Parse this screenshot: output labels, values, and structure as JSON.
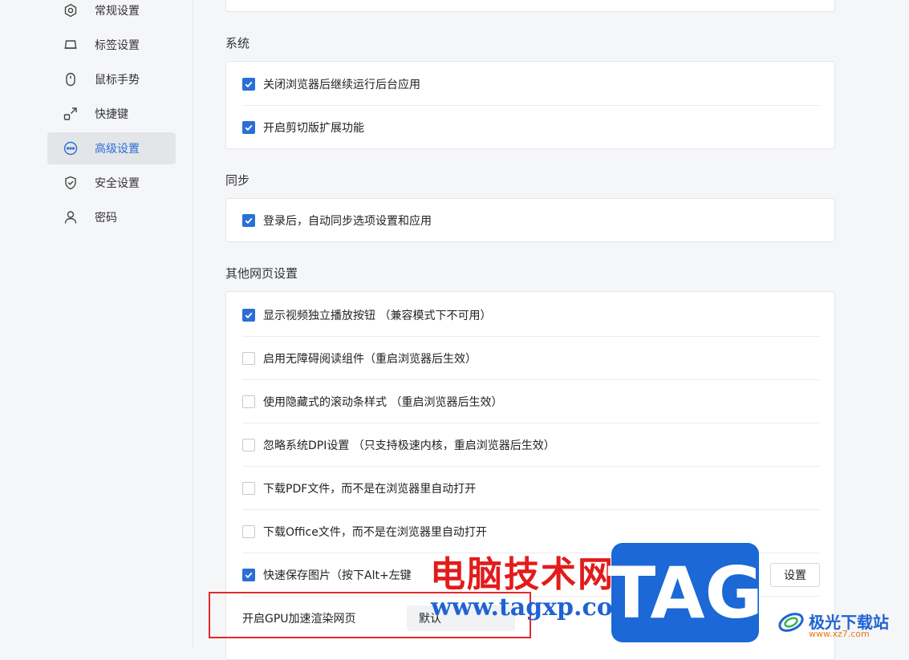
{
  "sidebar": {
    "items": [
      {
        "label": "常规设置",
        "icon": "hexagon-settings-icon"
      },
      {
        "label": "标签设置",
        "icon": "tab-icon"
      },
      {
        "label": "鼠标手势",
        "icon": "mouse-icon"
      },
      {
        "label": "快捷键",
        "icon": "shortcut-icon"
      },
      {
        "label": "高级设置",
        "icon": "more-icon",
        "active": true
      },
      {
        "label": "安全设置",
        "icon": "shield-icon"
      },
      {
        "label": "密码",
        "icon": "user-icon"
      }
    ]
  },
  "sections": {
    "system": {
      "title": "系统",
      "items": [
        {
          "label": "关闭浏览器后继续运行后台应用",
          "checked": true
        },
        {
          "label": "开启剪切版扩展功能",
          "checked": true
        }
      ]
    },
    "sync": {
      "title": "同步",
      "items": [
        {
          "label": "登录后，自动同步选项设置和应用",
          "checked": true
        }
      ]
    },
    "other": {
      "title": "其他网页设置",
      "items": [
        {
          "label": "显示视频独立播放按钮 （兼容模式下不可用）",
          "checked": true
        },
        {
          "label": "启用无障碍阅读组件（重启浏览器后生效）",
          "checked": false
        },
        {
          "label": "使用隐藏式的滚动条样式 （重启浏览器后生效）",
          "checked": false
        },
        {
          "label": "忽略系统DPI设置 （只支持极速内核，重启浏览器后生效）",
          "checked": false
        },
        {
          "label": "下载PDF文件，而不是在浏览器里自动打开",
          "checked": false
        },
        {
          "label": "下载Office文件，而不是在浏览器里自动打开",
          "checked": false
        },
        {
          "label": "快速保存图片（按下Alt+左键",
          "checked": true,
          "button": "设置"
        }
      ],
      "gpu": {
        "label": "开启GPU加速渲染网页",
        "value": "默认"
      }
    }
  },
  "watermark": {
    "title": "电脑技术网",
    "url": "www.tagxp.com",
    "tag": "TAG",
    "site_name": "极光下载站",
    "site_domain": "www.xz7.com"
  },
  "colors": {
    "accent": "#2b6fd6",
    "highlight": "#e02a2a"
  }
}
